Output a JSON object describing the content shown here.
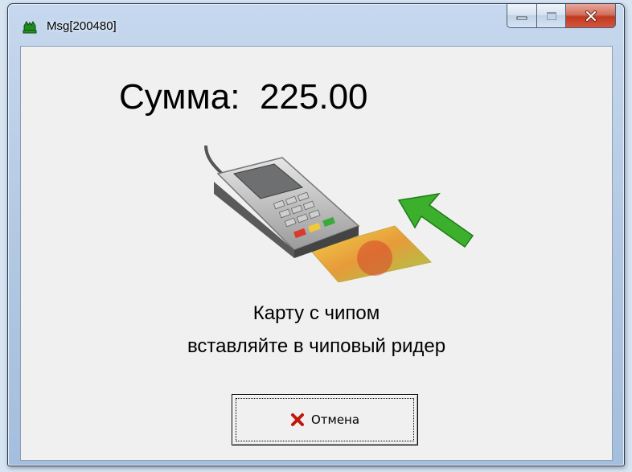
{
  "window": {
    "title": "Msg[200480]",
    "app_icon": "green-app-icon",
    "controls": [
      "minimize-icon",
      "maximize-icon",
      "close-icon"
    ]
  },
  "payment": {
    "amount_label": "Сумма:",
    "amount_value": "225.00",
    "image": "card-terminal-insert-illustration",
    "instruction_line1": "Карту с чипом",
    "instruction_line2": "вставляйте в чиповый ридер"
  },
  "buttons": {
    "cancel_label": "Отмена",
    "cancel_icon": "red-x-icon"
  },
  "colors": {
    "close_button": "#c8442b",
    "arrow": "#3cb02c",
    "cancel_x": "#c0180a"
  }
}
